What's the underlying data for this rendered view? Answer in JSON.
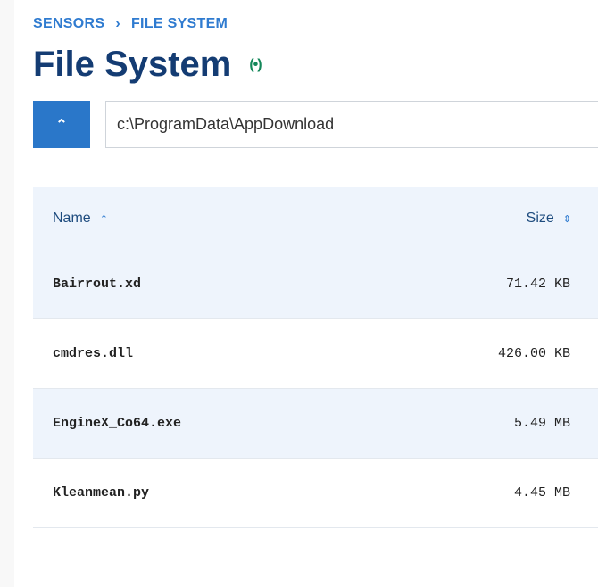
{
  "breadcrumb": {
    "items": [
      "SENSORS",
      "FILE SYSTEM"
    ],
    "separator": "›"
  },
  "page": {
    "title": "File System",
    "status_icon": "(•)"
  },
  "toolbar": {
    "up_label": "⌃",
    "path": "c:\\ProgramData\\AppDownload"
  },
  "table": {
    "columns": {
      "name": "Name",
      "name_sort": "⌃",
      "size": "Size",
      "size_sort": "⇕"
    },
    "rows": [
      {
        "name": "Bairrout.xd",
        "size": "71.42 KB"
      },
      {
        "name": "cmdres.dll",
        "size": "426.00 KB"
      },
      {
        "name": "EngineX_Co64.exe",
        "size": "5.49 MB"
      },
      {
        "name": "Kleanmean.py",
        "size": "4.45 MB"
      }
    ]
  }
}
